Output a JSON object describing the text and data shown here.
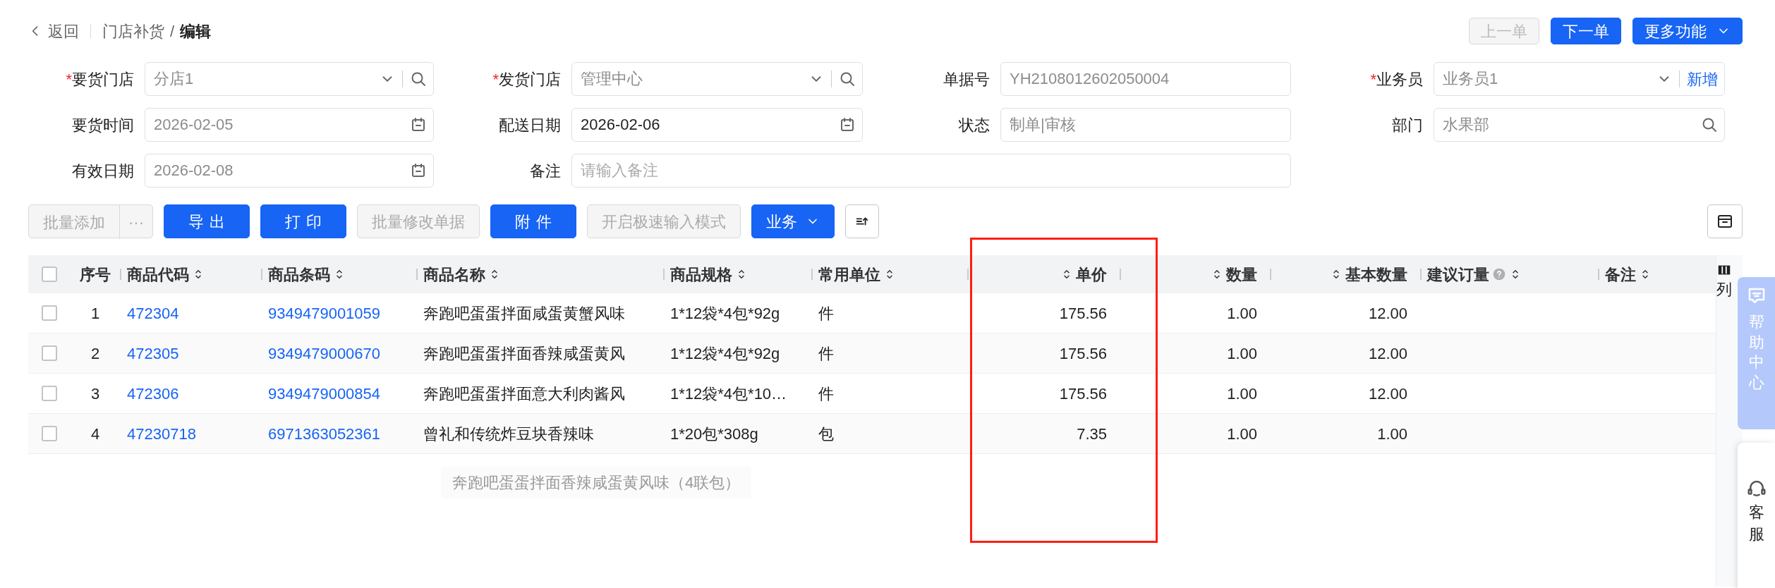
{
  "header": {
    "back": "返回",
    "breadcrumb": [
      "门店补货",
      "编辑"
    ],
    "separator": "/"
  },
  "nav_buttons": [
    {
      "label": "上一单",
      "disabled": true,
      "kind": "button"
    },
    {
      "label": "下一单",
      "disabled": false,
      "kind": "button"
    },
    {
      "label": "更多功能",
      "disabled": false,
      "kind": "dropdown"
    }
  ],
  "form": {
    "required_mark": "*",
    "fields": [
      {
        "label": "要货门店",
        "required": true,
        "kind": "select_search",
        "value": "分店1",
        "disabled": true
      },
      {
        "label": "发货门店",
        "required": true,
        "kind": "select_search",
        "value": "管理中心",
        "disabled": true
      },
      {
        "label": "单据号",
        "required": false,
        "kind": "text",
        "value": "YH2108012602050004",
        "disabled": true
      },
      {
        "label": "业务员",
        "required": true,
        "kind": "select_add",
        "value": "业务员1",
        "disabled": true,
        "action": "新增"
      },
      {
        "label": "要货时间",
        "required": false,
        "kind": "date",
        "value": "2026-02-05",
        "disabled": true
      },
      {
        "label": "配送日期",
        "required": false,
        "kind": "date",
        "value": "2026-02-06",
        "disabled": false
      },
      {
        "label": "状态",
        "required": false,
        "kind": "text",
        "value": "制单|审核",
        "disabled": true
      },
      {
        "label": "部门",
        "required": false,
        "kind": "search",
        "value": "水果部",
        "disabled": true
      },
      {
        "label": "有效日期",
        "required": false,
        "kind": "date",
        "value": "2026-02-08",
        "disabled": true
      },
      {
        "label": "备注",
        "required": false,
        "kind": "note",
        "placeholder": "请输入备注",
        "disabled": false
      }
    ]
  },
  "toolbar": [
    {
      "label": "批量添加",
      "kind": "split",
      "more": "···",
      "disabled": true
    },
    {
      "label": "导出",
      "kind": "button",
      "disabled": false
    },
    {
      "label": "打印",
      "kind": "button",
      "disabled": false
    },
    {
      "label": "批量修改单据",
      "kind": "button",
      "disabled": true
    },
    {
      "label": "附件",
      "kind": "button",
      "disabled": false
    },
    {
      "label": "开启极速输入模式",
      "kind": "button",
      "disabled": true
    },
    {
      "label": "业务",
      "kind": "dropdown",
      "disabled": false
    },
    {
      "kind": "icon",
      "disabled": false
    }
  ],
  "table": {
    "select_all": {
      "checked": false
    },
    "columns": [
      {
        "label": "序号",
        "kind": "index",
        "sortable": false,
        "help": false,
        "highlighted": false
      },
      {
        "label": "商品代码",
        "kind": "link",
        "sortable": true,
        "help": false,
        "highlighted": false
      },
      {
        "label": "商品条码",
        "kind": "link",
        "sortable": true,
        "help": false,
        "highlighted": false
      },
      {
        "label": "商品名称",
        "kind": "text",
        "sortable": true,
        "help": false,
        "highlighted": false
      },
      {
        "label": "商品规格",
        "kind": "text",
        "sortable": true,
        "help": false,
        "highlighted": false
      },
      {
        "label": "常用单位",
        "kind": "text",
        "sortable": true,
        "help": false,
        "highlighted": false
      },
      {
        "label": "单价",
        "kind": "number",
        "sortable": true,
        "help": false,
        "highlighted": true
      },
      {
        "label": "数量",
        "kind": "number",
        "sortable": true,
        "help": false,
        "highlighted": false
      },
      {
        "label": "基本数量",
        "kind": "number",
        "sortable": true,
        "help": false,
        "highlighted": false
      },
      {
        "label": "建议订量",
        "kind": "text",
        "sortable": true,
        "help": true,
        "highlighted": false
      },
      {
        "label": "备注",
        "kind": "text",
        "sortable": true,
        "help": false,
        "highlighted": false
      }
    ],
    "rows": [
      {
        "checked": false,
        "cells": [
          "1",
          "472304",
          "9349479001059",
          "奔跑吧蛋蛋拌面咸蛋黄蟹风味",
          "1*12袋*4包*92g",
          "件",
          "175.56",
          "1.00",
          "12.00",
          "",
          ""
        ]
      },
      {
        "checked": false,
        "cells": [
          "2",
          "472305",
          "9349479000670",
          "奔跑吧蛋蛋拌面香辣咸蛋黄风",
          "1*12袋*4包*92g",
          "件",
          "175.56",
          "1.00",
          "12.00",
          "",
          ""
        ]
      },
      {
        "checked": false,
        "cells": [
          "3",
          "472306",
          "9349479000854",
          "奔跑吧蛋蛋拌面意大利肉酱风",
          "1*12袋*4包*10…",
          "件",
          "175.56",
          "1.00",
          "12.00",
          "",
          ""
        ]
      },
      {
        "checked": false,
        "cells": [
          "4",
          "47230718",
          "6971363052361",
          "曾礼和传统炸豆块香辣味",
          "1*20包*308g",
          "包",
          "7.35",
          "1.00",
          "1.00",
          "",
          ""
        ]
      }
    ],
    "tooltip": {
      "text": "奔跑吧蛋蛋拌面香辣咸蛋黄风味（4联包）"
    },
    "column_settings": {
      "label": "列"
    }
  },
  "help_tab": {
    "label": "帮助中心"
  },
  "service": {
    "label": "客服"
  }
}
